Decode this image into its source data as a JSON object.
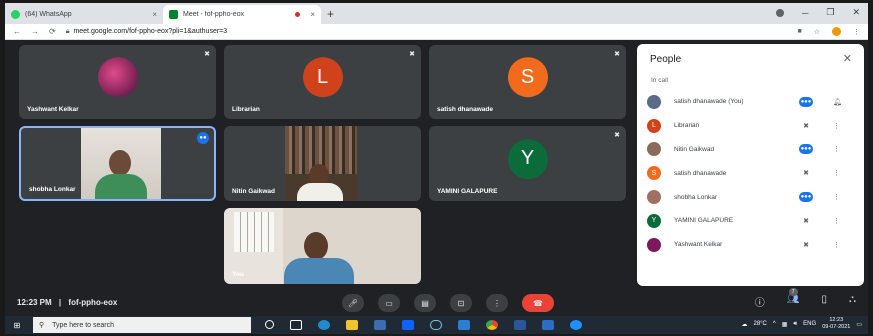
{
  "browser": {
    "tabs": [
      {
        "label": "(64) WhatsApp",
        "close": "×",
        "favicon_color": "#25d366"
      },
      {
        "label": "Meet - fof-ppho-eox",
        "close": "×",
        "favicon_color": "#00832d"
      }
    ],
    "new_tab": "+",
    "url": "meet.google.com/fof-ppho-eox?pli=1&authuser=3"
  },
  "meet": {
    "tiles": [
      {
        "name": "Yashwant Kelkar",
        "type": "photo",
        "color": "#7a1a5c"
      },
      {
        "name": "Librarian",
        "type": "letter",
        "letter": "L",
        "color": "#d0421b"
      },
      {
        "name": "satish dhanawade",
        "type": "letter",
        "letter": "S",
        "color": "#f26b1d"
      },
      {
        "name": "shobha Lonkar",
        "type": "video"
      },
      {
        "name": "Nitin Gaikwad",
        "type": "video"
      },
      {
        "name": "YAMINI GALAPURE",
        "type": "letter",
        "letter": "Y",
        "color": "#0b6b3a"
      },
      {
        "name": "You",
        "type": "video"
      }
    ],
    "time": "12:23 PM",
    "separator": "|",
    "meeting_code": "fof-ppho-eox",
    "participant_count": "7"
  },
  "people_panel": {
    "title": "People",
    "section": "In call",
    "participants": [
      {
        "name": "satish dhanawade (You)",
        "avatar_letter": "",
        "color": "#5b6b8a",
        "status": "speaking",
        "action": "pin"
      },
      {
        "name": "Librarian",
        "avatar_letter": "L",
        "color": "#d0421b",
        "status": "muted",
        "action": "more"
      },
      {
        "name": "Nitin Gaikwad",
        "avatar_letter": "",
        "color": "#8a6b5b",
        "status": "speaking",
        "action": "more"
      },
      {
        "name": "satish dhanawade",
        "avatar_letter": "S",
        "color": "#f26b1d",
        "status": "muted",
        "action": "more"
      },
      {
        "name": "shobha Lonkar",
        "avatar_letter": "",
        "color": "#a07060",
        "status": "speaking",
        "action": "more"
      },
      {
        "name": "YAMINI GALAPURE",
        "avatar_letter": "Y",
        "color": "#0b6b3a",
        "status": "muted",
        "action": "more"
      },
      {
        "name": "Yashwant Kelkar",
        "avatar_letter": "",
        "color": "#7a1a5c",
        "status": "muted",
        "action": "more"
      }
    ]
  },
  "taskbar": {
    "search_placeholder": "Type here to search",
    "temperature": "28°C",
    "language": "ENG",
    "time": "12:23",
    "date": "09-07-2021"
  }
}
